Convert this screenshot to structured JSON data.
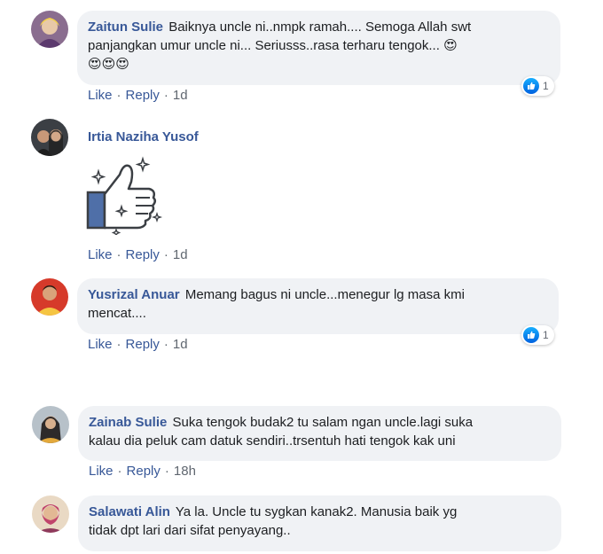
{
  "comments": [
    {
      "author": "Zaitun Sulie",
      "text_line1": "Baiknya uncle ni..nmpk ramah.... Semoga Allah swt",
      "text_line2": "panjangkan umur uncle ni... Seriusss..rasa terharu tengok...",
      "emoji_end": "😍",
      "emoji_row": "😍😍😍",
      "like_label": "Like",
      "reply_label": "Reply",
      "time": "1d",
      "reaction_count": "1"
    },
    {
      "author": "Irtia Naziha Yusof",
      "sticker": "thumbs-up-sparkle-sticker",
      "like_label": "Like",
      "reply_label": "Reply",
      "time": "1d"
    },
    {
      "author": "Yusrizal Anuar",
      "text_line1": "Memang bagus ni uncle...menegur lg masa kmi",
      "text_line2": "mencat....",
      "like_label": "Like",
      "reply_label": "Reply",
      "time": "1d",
      "reaction_count": "1"
    },
    {
      "author": "Zainab Sulie",
      "text_line1": "Suka tengok budak2 tu salam ngan uncle.lagi suka",
      "text_line2": "kalau dia peluk cam datuk sendiri..trsentuh hati tengok kak uni",
      "like_label": "Like",
      "reply_label": "Reply",
      "time": "18h"
    },
    {
      "author": "Salawati Alin",
      "text_line1": "Ya la. Uncle tu sygkan kanak2. Manusia baik yg",
      "text_line2": "tidak dpt lari dari sifat penyayang.."
    }
  ],
  "colors": {
    "author": "#385898",
    "bubble": "#f0f2f5",
    "like_gradient_top": "#18afff",
    "like_gradient_bottom": "#0062df"
  },
  "icons": {
    "reaction": "like-reaction-icon",
    "sticker": "thumbs-up-sparkle-sticker"
  }
}
